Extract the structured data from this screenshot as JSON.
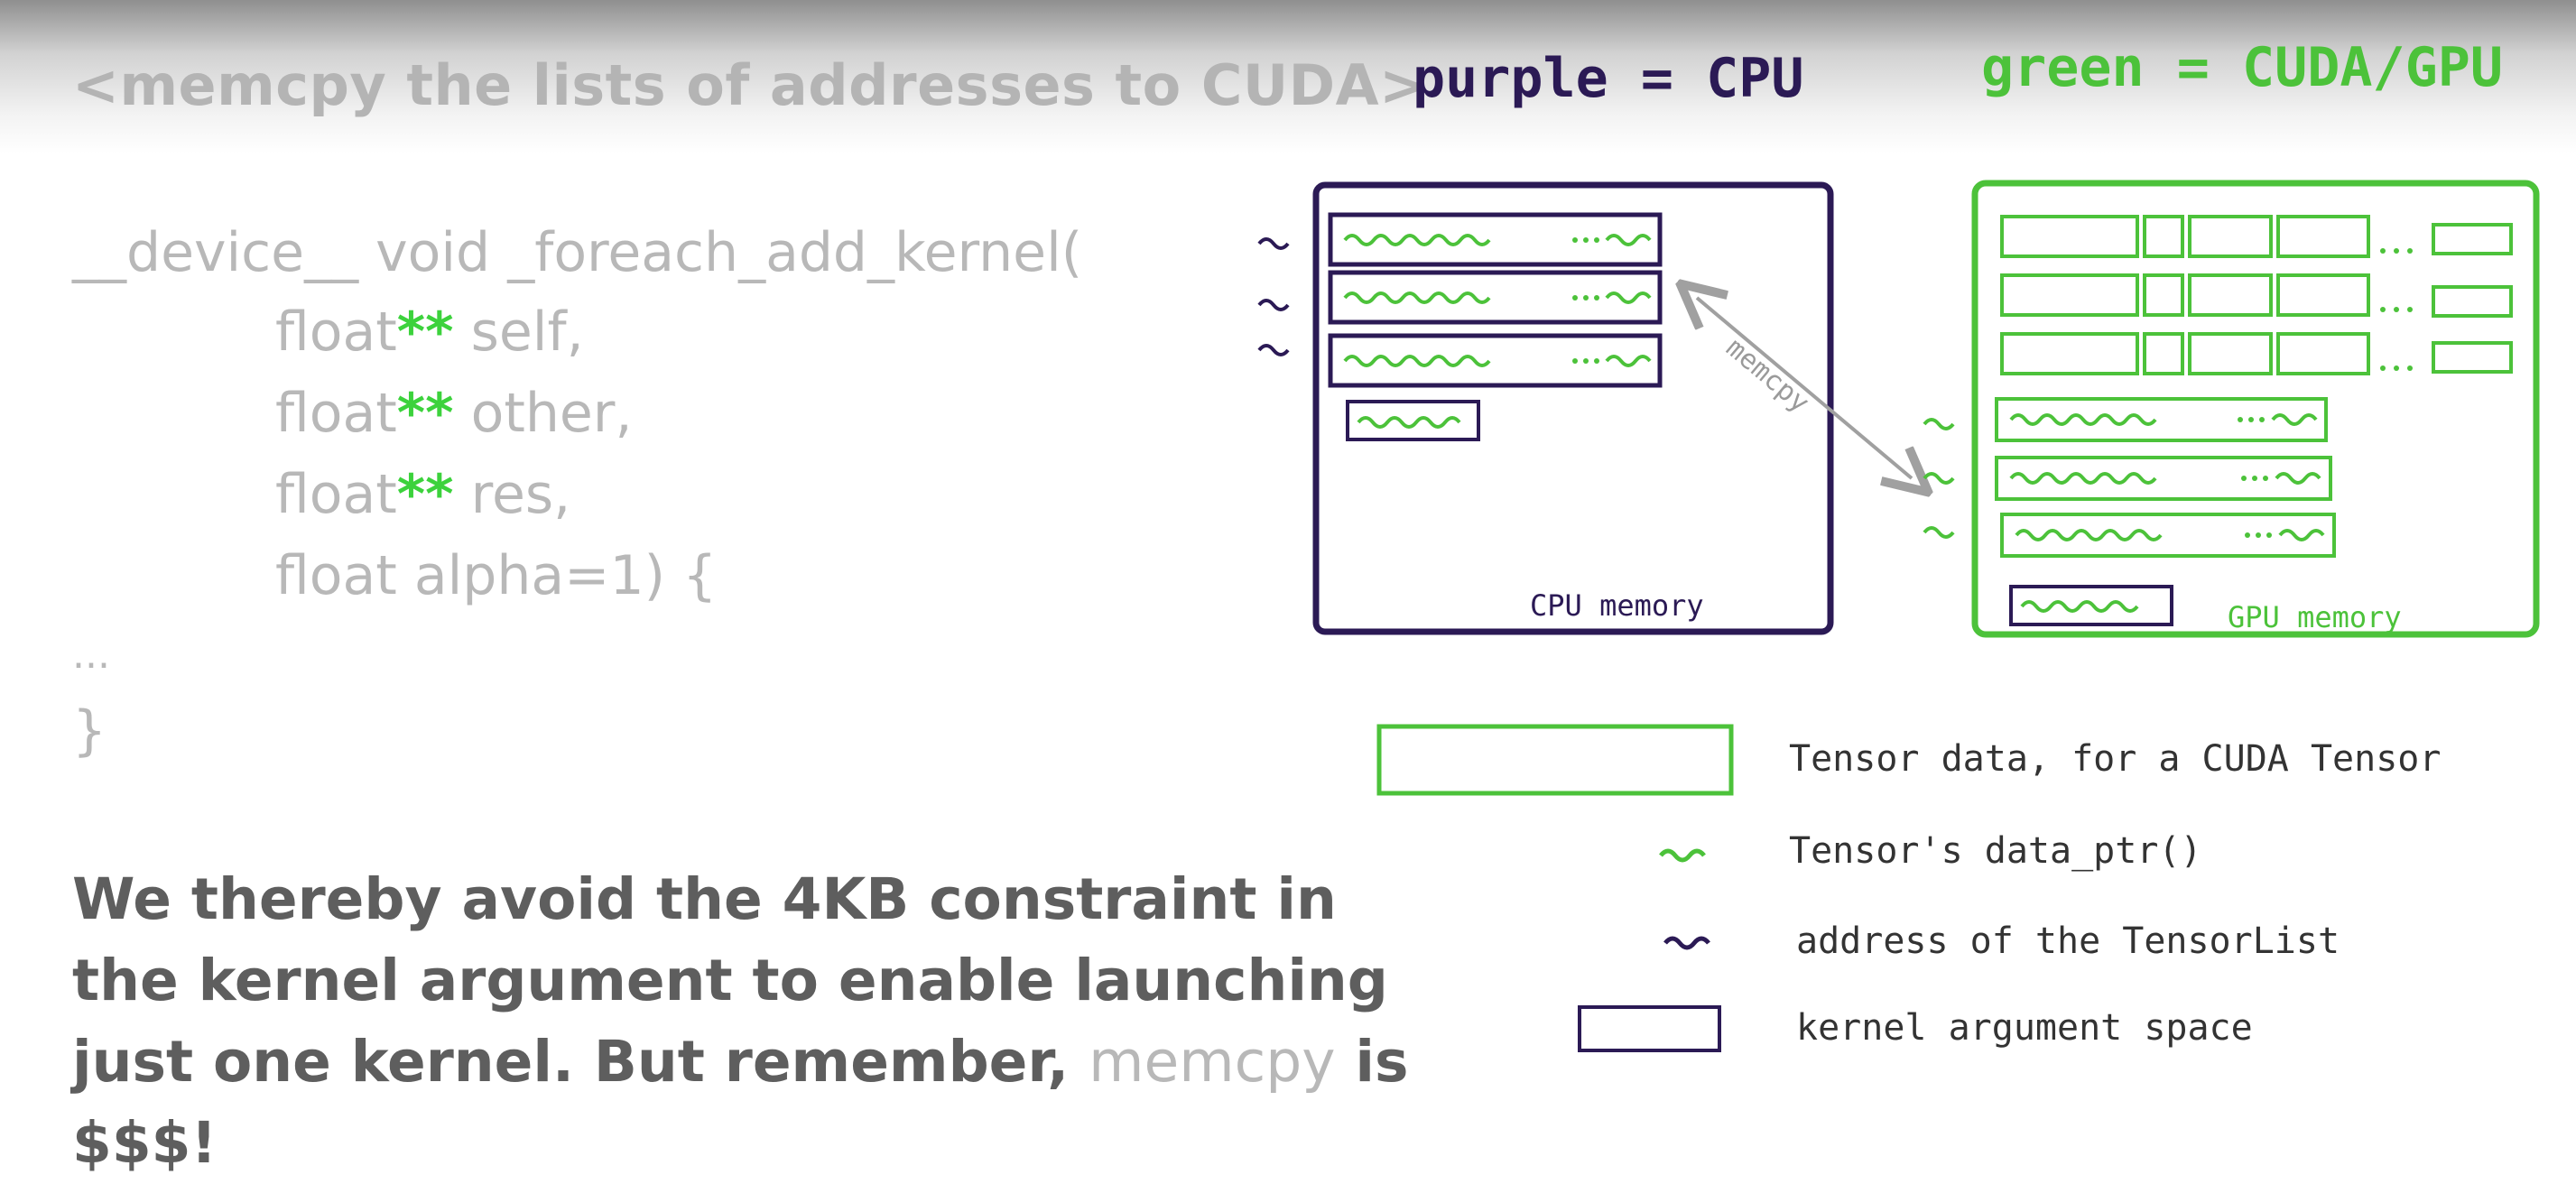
{
  "header": {
    "title": "<memcpy the lists of addresses to CUDA>"
  },
  "legend_colors": {
    "cpu_label": "purple = CPU",
    "gpu_label": "green = CUDA/GPU",
    "cpu_color": "#2b1a55",
    "gpu_color": "#4cc23a"
  },
  "code": {
    "signature": "__device__ void _foreach_add_kernel(",
    "params": [
      {
        "type": "float",
        "stars": "**",
        "name": " self,"
      },
      {
        "type": "float",
        "stars": "**",
        "name": " other,"
      },
      {
        "type": "float",
        "stars": "**",
        "name": " res,"
      },
      {
        "type": "float alpha=1) {",
        "stars": "",
        "name": ""
      }
    ],
    "ellipsis": "...",
    "closing": "}"
  },
  "note": {
    "part1": "We thereby avoid the 4KB constraint in the kernel argument to enable launching just one kernel. But remember, ",
    "memcpy": "memcpy",
    "part2": " is $$$!"
  },
  "diagram": {
    "cpu_memory_label": "CPU memory",
    "gpu_memory_label": "GPU memory",
    "arrow_label": "memcpy",
    "cpu_rows": 3,
    "gpu_tensor_rows": 3,
    "gpu_list_rows": 3
  },
  "legend": [
    {
      "icon": "green-box-icon",
      "text": "Tensor data, for a CUDA Tensor"
    },
    {
      "icon": "green-squiggle-icon",
      "text": "Tensor's data_ptr()"
    },
    {
      "icon": "purple-squiggle-icon",
      "text": "address of the TensorList"
    },
    {
      "icon": "dark-box-icon",
      "text": "kernel argument space"
    }
  ]
}
